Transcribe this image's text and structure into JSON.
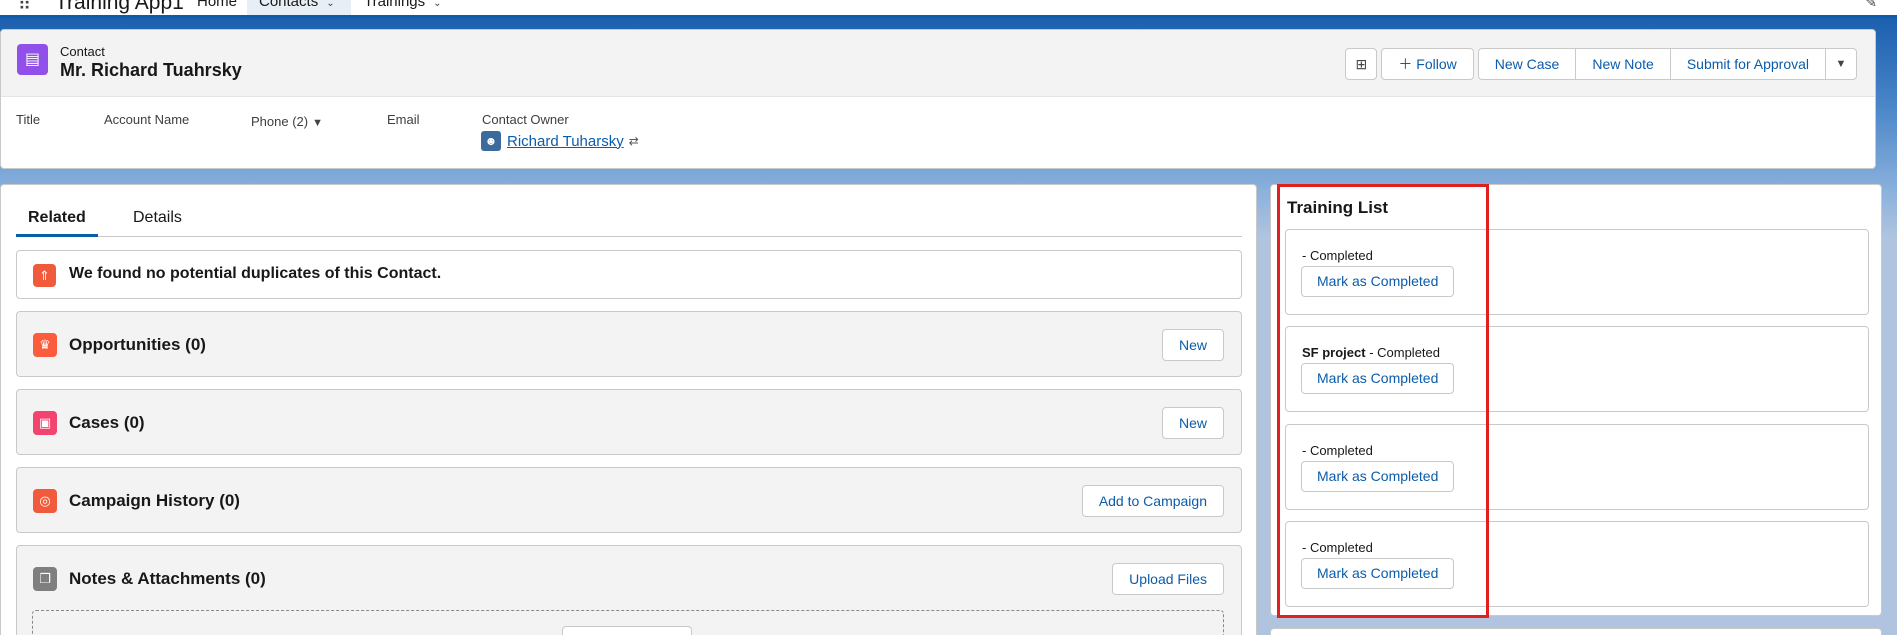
{
  "nav": {
    "app_name": "Training App1",
    "launcher_icon": "app-launcher-icon",
    "items": [
      {
        "label": "Home"
      },
      {
        "label": "Contacts"
      },
      {
        "label": "Trainings"
      }
    ]
  },
  "record": {
    "entity_type": "Contact",
    "name": "Mr. Richard Tuahrsky",
    "actions": {
      "follow": "Follow",
      "new_case": "New Case",
      "new_note": "New Note",
      "submit": "Submit for Approval"
    },
    "fields": {
      "title": "Title",
      "account_name": "Account Name",
      "phone": "Phone (2)",
      "email": "Email",
      "contact_owner": "Contact Owner",
      "owner_name": "Richard Tuharsky"
    }
  },
  "tabs": [
    {
      "label": "Related"
    },
    {
      "label": "Details"
    }
  ],
  "duplicates_message": "We found no potential duplicates of this Contact.",
  "related_lists": [
    {
      "title": "Opportunities (0)",
      "button": "New"
    },
    {
      "title": "Cases (0)",
      "button": "New"
    },
    {
      "title": "Campaign History (0)",
      "button": "Add to Campaign"
    },
    {
      "title": "Notes & Attachments (0)",
      "button": "Upload Files"
    }
  ],
  "training_list": {
    "title": "Training List",
    "items": [
      {
        "name": "",
        "status": "- Completed",
        "button": "Mark as Completed"
      },
      {
        "name": "SF project",
        "status": " - Completed",
        "button": "Mark as Completed"
      },
      {
        "name": "",
        "status": "- Completed",
        "button": "Mark as Completed"
      },
      {
        "name": "",
        "status": "- Completed",
        "button": "Mark as Completed"
      }
    ]
  },
  "colors": {
    "brand_blue": "#0b5cab",
    "contact_icon": "#9050e9",
    "highlight": "#e02020"
  }
}
